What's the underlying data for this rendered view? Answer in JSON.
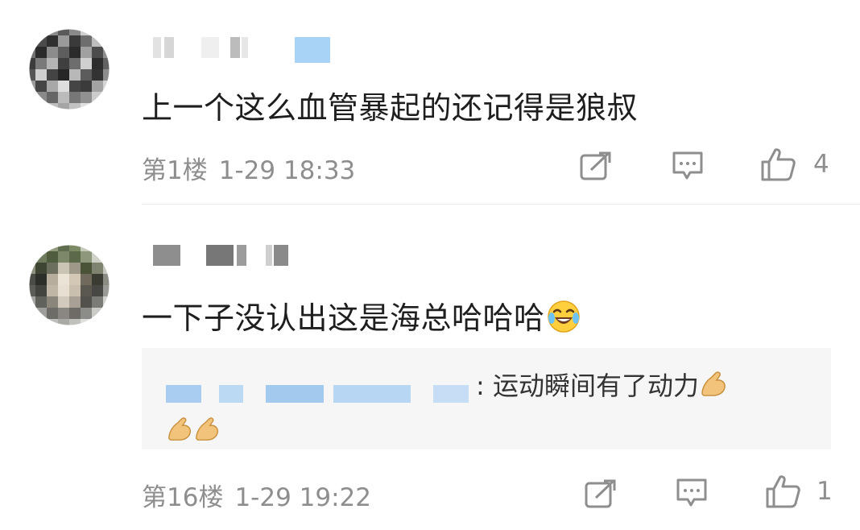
{
  "comments": [
    {
      "text": "上一个这么血管暴起的还记得是狼叔",
      "floor": "第1楼",
      "time": "1-29 18:33",
      "likes": "4"
    },
    {
      "text": "一下子没认出这是海总哈哈哈",
      "text_emoji": "laughing-crying-emoji",
      "floor": "第16楼",
      "time": "1-29 19:22",
      "likes": "1",
      "quote": {
        "text": ": 运动瞬间有了动力",
        "emoji": "flexed-biceps-emoji"
      }
    }
  ],
  "icons": {
    "share": "share-icon",
    "comment": "comment-icon",
    "like": "thumbs-up-icon"
  },
  "colors": {
    "text": "#1e1e1e",
    "meta": "#8e8e8e",
    "quote_bg": "#f6f6f6",
    "blur_blue": "#a9d2f7"
  }
}
